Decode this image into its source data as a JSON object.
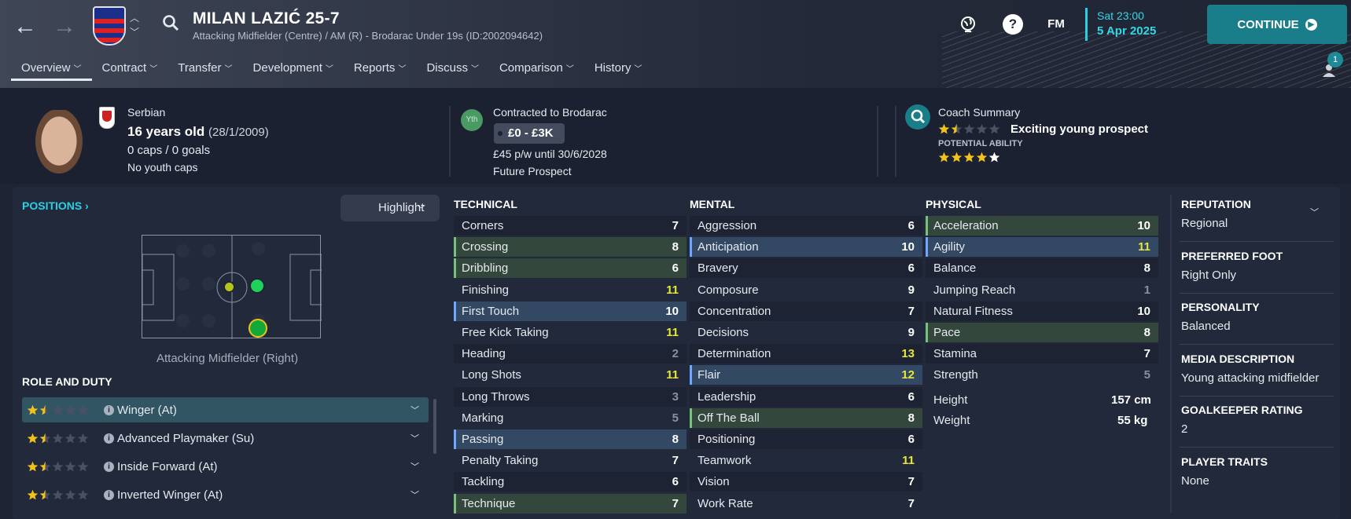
{
  "header": {
    "player_name": "MILAN LAZIĆ 25-7",
    "subtitle": "Attacking Midfielder (Centre) / AM (R) - Brodarac Under 19s (ID:2002094642)",
    "fm_label": "FM",
    "help_label": "?",
    "date_time": "Sat 23:00",
    "date": "5 Apr 2025",
    "continue_label": "CONTINUE",
    "notification_count": "1"
  },
  "tabs": [
    {
      "label": "Overview"
    },
    {
      "label": "Contract"
    },
    {
      "label": "Transfer"
    },
    {
      "label": "Development"
    },
    {
      "label": "Reports"
    },
    {
      "label": "Discuss"
    },
    {
      "label": "Comparison"
    },
    {
      "label": "History"
    }
  ],
  "info": {
    "nationality": "Serbian",
    "age": "16 years old",
    "dob": "(28/1/2009)",
    "caps": "0 caps / 0 goals",
    "youth_caps": "No youth caps",
    "yth_badge": "Yth",
    "contract_title": "Contracted to Brodarac",
    "value": "£0 - £3K",
    "wage": "£45 p/w until 30/6/2028",
    "status": "Future Prospect",
    "coach_title": "Coach Summary",
    "coach_text": "Exciting young prospect",
    "current_ability_stars": 1.5,
    "potential_label": "POTENTIAL ABILITY",
    "potential_ability_stars": 4.5
  },
  "positions": {
    "label": "POSITIONS",
    "highlight_label": "Highlight",
    "position_caption": "Attacking Midfielder (Right)"
  },
  "roles": {
    "header": "ROLE AND DUTY",
    "items": [
      {
        "label": "Winger (At)",
        "stars": 1.5
      },
      {
        "label": "Advanced Playmaker (Su)",
        "stars": 1.5
      },
      {
        "label": "Inside Forward (At)",
        "stars": 1.5
      },
      {
        "label": "Inverted Winger (At)",
        "stars": 1.5
      }
    ]
  },
  "technical": {
    "header": "TECHNICAL",
    "items": [
      {
        "name": "Corners",
        "value": "7",
        "hl": ""
      },
      {
        "name": "Crossing",
        "value": "8",
        "hl": "gr"
      },
      {
        "name": "Dribbling",
        "value": "6",
        "hl": "gr"
      },
      {
        "name": "Finishing",
        "value": "11",
        "hl": ""
      },
      {
        "name": "First Touch",
        "value": "10",
        "hl": "bl"
      },
      {
        "name": "Free Kick Taking",
        "value": "11",
        "hl": ""
      },
      {
        "name": "Heading",
        "value": "2",
        "hl": ""
      },
      {
        "name": "Long Shots",
        "value": "11",
        "hl": ""
      },
      {
        "name": "Long Throws",
        "value": "3",
        "hl": ""
      },
      {
        "name": "Marking",
        "value": "5",
        "hl": ""
      },
      {
        "name": "Passing",
        "value": "8",
        "hl": "bl"
      },
      {
        "name": "Penalty Taking",
        "value": "7",
        "hl": ""
      },
      {
        "name": "Tackling",
        "value": "6",
        "hl": ""
      },
      {
        "name": "Technique",
        "value": "7",
        "hl": "gr"
      }
    ]
  },
  "mental": {
    "header": "MENTAL",
    "items": [
      {
        "name": "Aggression",
        "value": "6",
        "hl": ""
      },
      {
        "name": "Anticipation",
        "value": "10",
        "hl": "bl"
      },
      {
        "name": "Bravery",
        "value": "6",
        "hl": ""
      },
      {
        "name": "Composure",
        "value": "9",
        "hl": ""
      },
      {
        "name": "Concentration",
        "value": "7",
        "hl": ""
      },
      {
        "name": "Decisions",
        "value": "9",
        "hl": ""
      },
      {
        "name": "Determination",
        "value": "13",
        "hl": ""
      },
      {
        "name": "Flair",
        "value": "12",
        "hl": "bl"
      },
      {
        "name": "Leadership",
        "value": "6",
        "hl": ""
      },
      {
        "name": "Off The Ball",
        "value": "8",
        "hl": "gr"
      },
      {
        "name": "Positioning",
        "value": "6",
        "hl": ""
      },
      {
        "name": "Teamwork",
        "value": "11",
        "hl": ""
      },
      {
        "name": "Vision",
        "value": "7",
        "hl": ""
      },
      {
        "name": "Work Rate",
        "value": "7",
        "hl": ""
      }
    ]
  },
  "physical": {
    "header": "PHYSICAL",
    "items": [
      {
        "name": "Acceleration",
        "value": "10",
        "hl": "gr"
      },
      {
        "name": "Agility",
        "value": "11",
        "hl": "bl"
      },
      {
        "name": "Balance",
        "value": "8",
        "hl": ""
      },
      {
        "name": "Jumping Reach",
        "value": "1",
        "hl": ""
      },
      {
        "name": "Natural Fitness",
        "value": "10",
        "hl": ""
      },
      {
        "name": "Pace",
        "value": "8",
        "hl": "gr"
      },
      {
        "name": "Stamina",
        "value": "7",
        "hl": ""
      },
      {
        "name": "Strength",
        "value": "5",
        "hl": ""
      }
    ],
    "height_label": "Height",
    "height": "157 cm",
    "weight_label": "Weight",
    "weight": "55 kg"
  },
  "side": [
    {
      "label": "REPUTATION",
      "value": "Regional"
    },
    {
      "label": "PREFERRED FOOT",
      "value": "Right Only"
    },
    {
      "label": "PERSONALITY",
      "value": "Balanced"
    },
    {
      "label": "MEDIA DESCRIPTION",
      "value": "Young attacking midfielder"
    },
    {
      "label": "GOALKEEPER RATING",
      "value": "2"
    },
    {
      "label": "PLAYER TRAITS",
      "value": "None"
    }
  ],
  "colors": {
    "accent": "#2ad0e4",
    "continue": "#1a7d8a",
    "star": "#f2c21b",
    "highlight_value": "#e8e63a"
  }
}
